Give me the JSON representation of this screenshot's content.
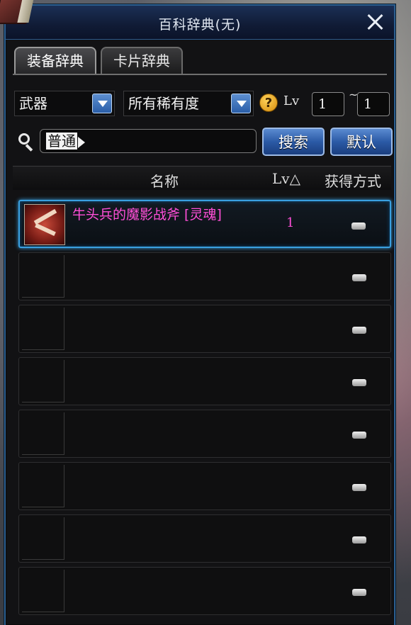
{
  "window": {
    "title": "百科辞典(无)"
  },
  "tabs": [
    {
      "label": "装备辞典",
      "active": true
    },
    {
      "label": "卡片辞典",
      "active": false
    }
  ],
  "filters": {
    "category": "武器",
    "rarity": "所有稀有度",
    "help_glyph": "?",
    "lv_label": "Lv",
    "lv_min": "1",
    "lv_sep": "~",
    "lv_max": "1"
  },
  "search": {
    "value": "普通",
    "search_button": "搜索",
    "default_button": "默认"
  },
  "table": {
    "columns": {
      "name": "名称",
      "lv": "Lv△",
      "source": "获得方式"
    },
    "rows": [
      {
        "name": "牛头兵的魔影战斧 [灵魂]",
        "lv": "1",
        "source_icon": "dash-icon",
        "selected": true
      },
      {
        "name": "",
        "lv": "",
        "source_icon": "dash-icon"
      },
      {
        "name": "",
        "lv": "",
        "source_icon": "dash-icon"
      },
      {
        "name": "",
        "lv": "",
        "source_icon": "dash-icon"
      },
      {
        "name": "",
        "lv": "",
        "source_icon": "dash-icon"
      },
      {
        "name": "",
        "lv": "",
        "source_icon": "dash-icon"
      },
      {
        "name": "",
        "lv": "",
        "source_icon": "dash-icon"
      },
      {
        "name": "",
        "lv": "",
        "source_icon": "dash-icon"
      }
    ]
  },
  "colors": {
    "accent": "#3aa0e0",
    "item_name": "#ff4fd8"
  }
}
